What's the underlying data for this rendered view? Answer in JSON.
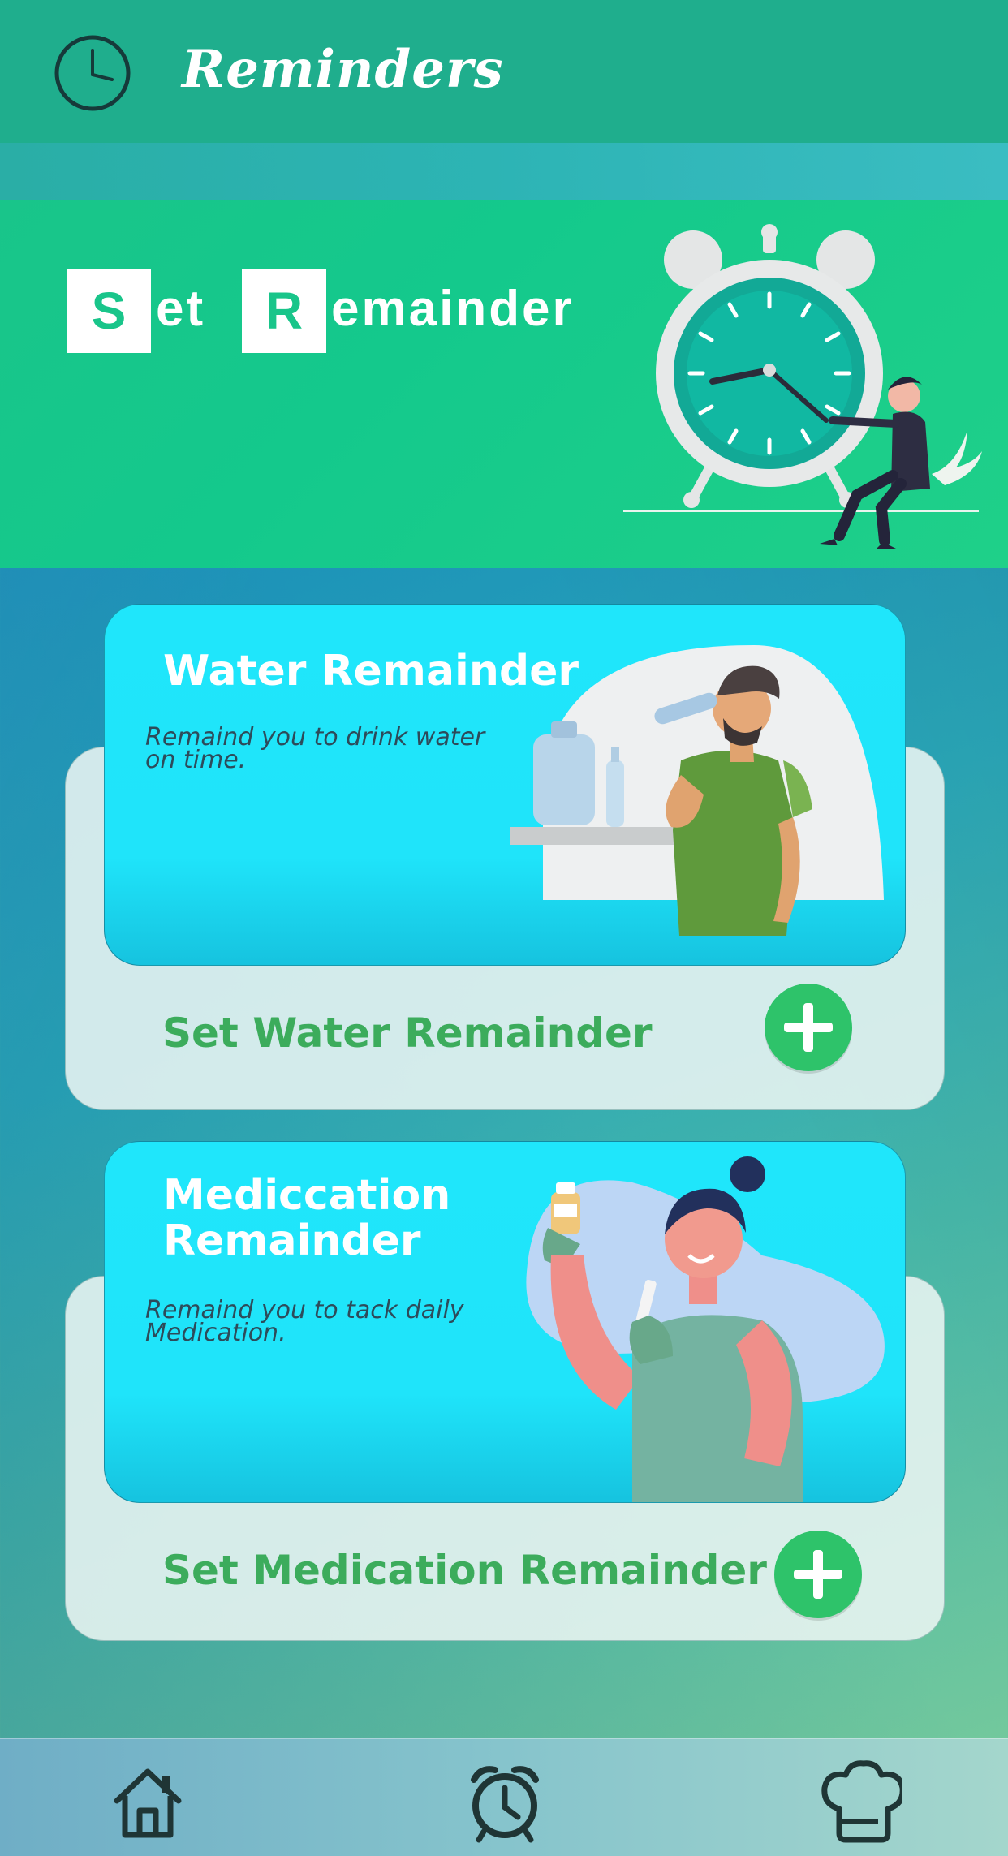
{
  "header": {
    "title": "Reminders",
    "icon": "clock-icon"
  },
  "banner": {
    "title_first_letter": "S",
    "title_first_rest": "et",
    "title_second_letter": "R",
    "title_second_rest": "emainder",
    "illustration": "alarm-clock-with-person-illustration"
  },
  "cards": [
    {
      "title": "Water Remainder",
      "description": "Remaind you to drink water on time.",
      "action_label": "Set Water Remainder",
      "action_icon": "plus-icon",
      "illustration": "man-drinking-water-illustration"
    },
    {
      "title_line1": "Mediccation",
      "title_line2": "Remainder",
      "description": "Remaind you to tack daily Medication.",
      "action_label": "Set Medication Remainder",
      "action_icon": "plus-icon",
      "illustration": "woman-with-medication-illustration"
    }
  ],
  "bottom_nav": {
    "items": [
      "home-icon",
      "alarm-clock-icon",
      "chef-hat-icon"
    ]
  },
  "colors": {
    "header": "#1fae8d",
    "banner": "#19c58a",
    "card_front": "#1fe4fa",
    "action_text": "#3cac5c",
    "plus_button": "#2ec36a"
  }
}
